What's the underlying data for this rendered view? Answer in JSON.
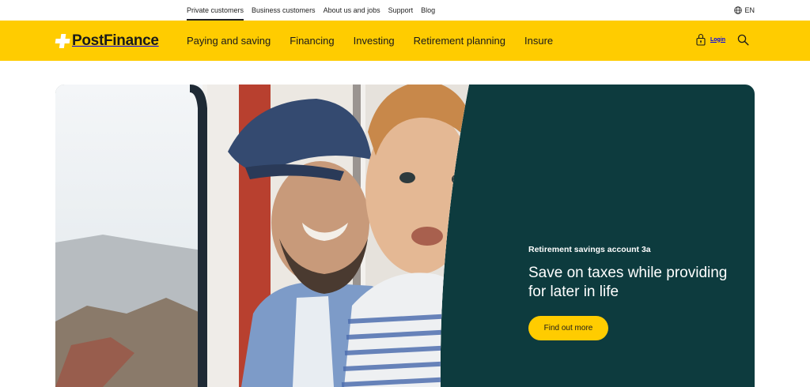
{
  "topnav": {
    "items": [
      {
        "label": "Private customers"
      },
      {
        "label": "Business customers"
      },
      {
        "label": "About us and jobs"
      },
      {
        "label": "Support"
      },
      {
        "label": "Blog"
      }
    ],
    "language": "EN"
  },
  "header": {
    "logo_text": "PostFinance",
    "nav": [
      {
        "label": "Paying and saving"
      },
      {
        "label": "Financing"
      },
      {
        "label": "Investing"
      },
      {
        "label": "Retirement planning"
      },
      {
        "label": "Insure"
      }
    ],
    "login_label": "Login"
  },
  "hero": {
    "eyebrow": "Retirement savings account 3a",
    "headline": "Save on taxes while providing for later in life",
    "cta_label": "Find out more"
  },
  "colors": {
    "brand_yellow": "#ffcc00",
    "hero_dark": "#0d3b3e"
  }
}
